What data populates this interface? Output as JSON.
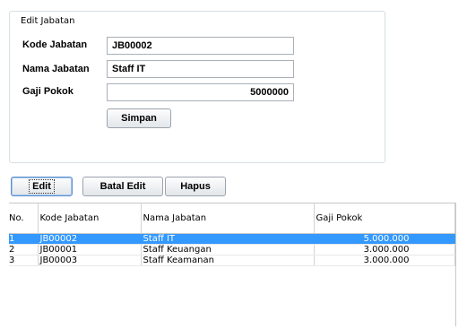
{
  "form": {
    "group_title": "Edit Jabatan",
    "kode_label": "Kode Jabatan",
    "kode_value": "JB00002",
    "nama_label": "Nama Jabatan",
    "nama_value": "Staff IT",
    "gaji_label": "Gaji Pokok",
    "gaji_value": "5000000",
    "simpan_label": "Simpan"
  },
  "actions": {
    "edit_label": "Edit",
    "batal_label": "Batal Edit",
    "hapus_label": "Hapus"
  },
  "table": {
    "headers": [
      "No.",
      "Kode Jabatan",
      "Nama Jabatan",
      "Gaji Pokok"
    ],
    "rows": [
      [
        "1",
        "JB00002",
        "Staff IT",
        "5.000.000"
      ],
      [
        "2",
        "JB00001",
        "Staff Keuangan",
        "3.000.000"
      ],
      [
        "3",
        "JB00003",
        "Staff Keamanan",
        "3.000.000"
      ]
    ],
    "selected_row": 1
  },
  "colors": {
    "selection": "#3399ff",
    "group_border": "#d5dfe5"
  }
}
